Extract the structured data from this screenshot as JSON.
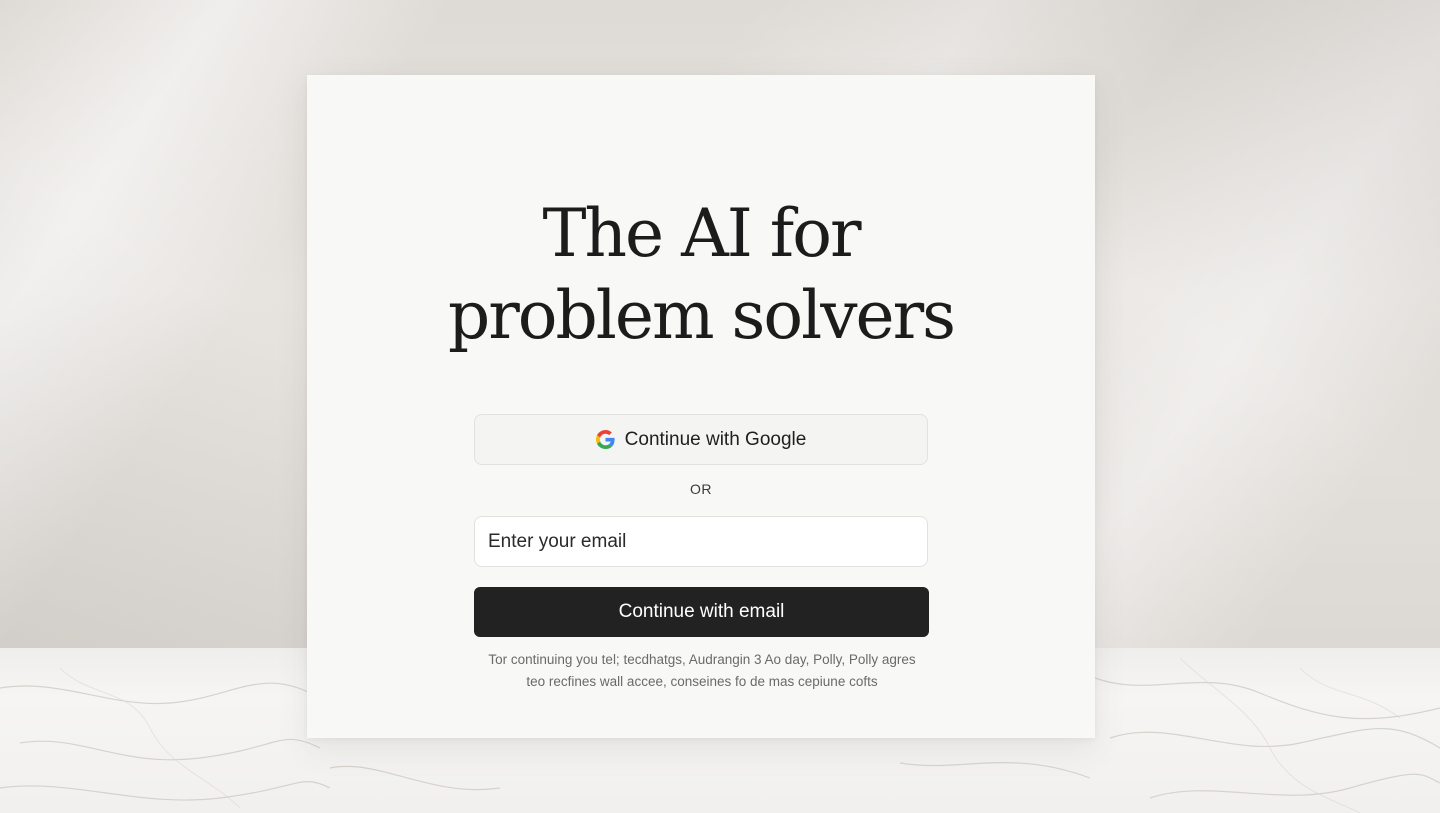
{
  "headline": {
    "line1": "The AI for",
    "line2": "problem solvers"
  },
  "google_button": {
    "label": "Continue with Google",
    "icon": "google-g-icon"
  },
  "divider": {
    "label": "OR"
  },
  "email_field": {
    "placeholder": "Enter your email",
    "value": ""
  },
  "email_button": {
    "label": "Continue with email"
  },
  "legal": {
    "line1": "Tor continuing you tel; tecdhatgs, Audrangin 3 Ao day, Polly, Polly agres",
    "line2": "teo recfines wall accee, conseines fo de mas cepiune cofts"
  },
  "colors": {
    "card_background": "#f8f8f7",
    "primary_button": "#222222",
    "text": "#1c1c1c",
    "muted_text": "#6a6a6a"
  }
}
